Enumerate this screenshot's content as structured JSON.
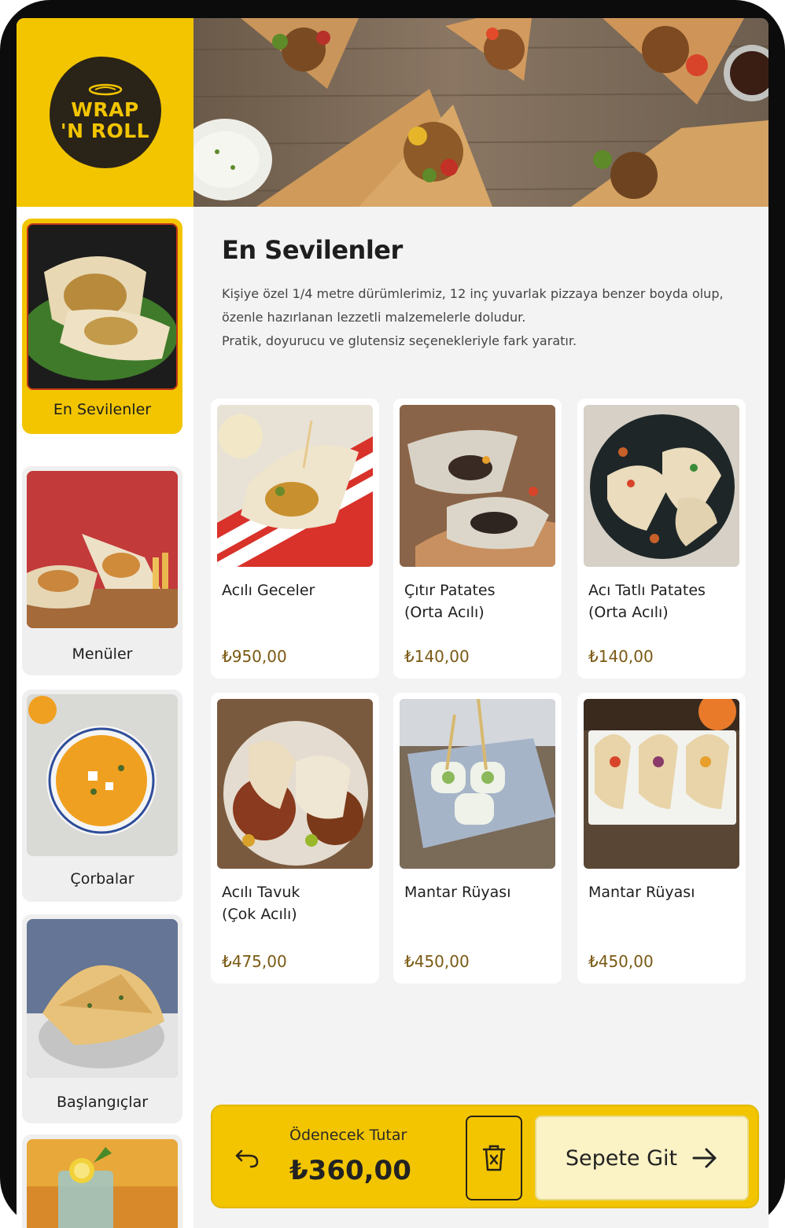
{
  "brand": {
    "logo_line1": "WRAP",
    "logo_line2": "'N ROLL",
    "accent_color": "#f2c500",
    "dark_color": "#2a2318"
  },
  "sidebar": {
    "categories": [
      {
        "label": "En Sevilenler",
        "active": true,
        "image": "wrap-photo"
      },
      {
        "label": "Menüler",
        "active": false,
        "image": "wrap-fries-photo"
      },
      {
        "label": "Çorbalar",
        "active": false,
        "image": "soup-photo"
      },
      {
        "label": "Başlangıçlar",
        "active": false,
        "image": "flatbread-photo"
      },
      {
        "label": "",
        "active": false,
        "image": "lemonade-photo"
      }
    ]
  },
  "main": {
    "title": "En Sevilenler",
    "description": [
      "Kişiye özel 1/4 metre dürümlerimiz, 12 inç yuvarlak pizzaya benzer boyda olup,",
      "özenle hazırlanan lezzetli malzemelerle doludur.",
      "Pratik, doyurucu ve glutensiz seçenekleriyle fark yaratır."
    ],
    "products": [
      {
        "name": "Acılı Geceler",
        "price": "₺950,00"
      },
      {
        "name": "Çıtır Patates\n(Orta Acılı)",
        "price": "₺140,00"
      },
      {
        "name": "Acı Tatlı Patates\n(Orta Acılı)",
        "price": "₺140,00"
      },
      {
        "name": "Acılı Tavuk\n(Çok Acılı)",
        "price": "₺475,00"
      },
      {
        "name": "Mantar Rüyası",
        "price": "₺450,00"
      },
      {
        "name": "Mantar Rüyası",
        "price": "₺450,00"
      }
    ]
  },
  "cart": {
    "total_label": "Ödenecek Tutar",
    "total_value": "₺360,00",
    "go_label": "Sepete Git",
    "back_icon": "undo-arrow-icon",
    "trash_icon": "trash-icon",
    "go_icon": "arrow-right-icon"
  }
}
